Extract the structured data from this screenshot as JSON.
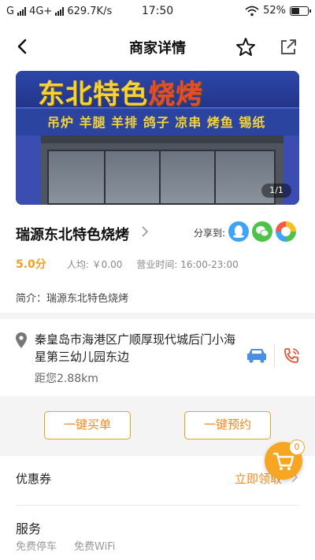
{
  "status_bar": {
    "carrier_left": "G",
    "network": "4G+",
    "speed": "629.7K/s",
    "time": "17:50",
    "battery": "52%",
    "battery_level": 0.52
  },
  "nav": {
    "title": "商家详情"
  },
  "hero": {
    "sign_name_main": "东北特色",
    "sign_name_accent": "烧烤",
    "sign_items": "吊炉 羊腿 羊排 鸽子 凉串 烤鱼 锡纸",
    "image_counter": "1/1"
  },
  "store": {
    "name": "瑞源东北特色烧烤",
    "share_label": "分享到:",
    "rating": "5.0分",
    "avg_price": "人均: ￥0.00",
    "hours": "营业时间: 16:00-23:00",
    "intro": "简介：瑞源东北特色烧烤",
    "address": "秦皇岛市海港区广顺厚现代城后门小海星第三幼儿园东边",
    "distance": "距您2.88km"
  },
  "actions": {
    "buy_label": "一键买单",
    "book_label": "一键预约"
  },
  "coupon": {
    "label": "优惠券",
    "action": "立即领取"
  },
  "cart": {
    "count": "0"
  },
  "services": {
    "title": "服务",
    "tags": [
      "免费停车",
      "免费WiFi"
    ]
  },
  "colors": {
    "accent": "#f0a020",
    "qq": "#3fa4f5",
    "wechat": "#4fc24a"
  }
}
